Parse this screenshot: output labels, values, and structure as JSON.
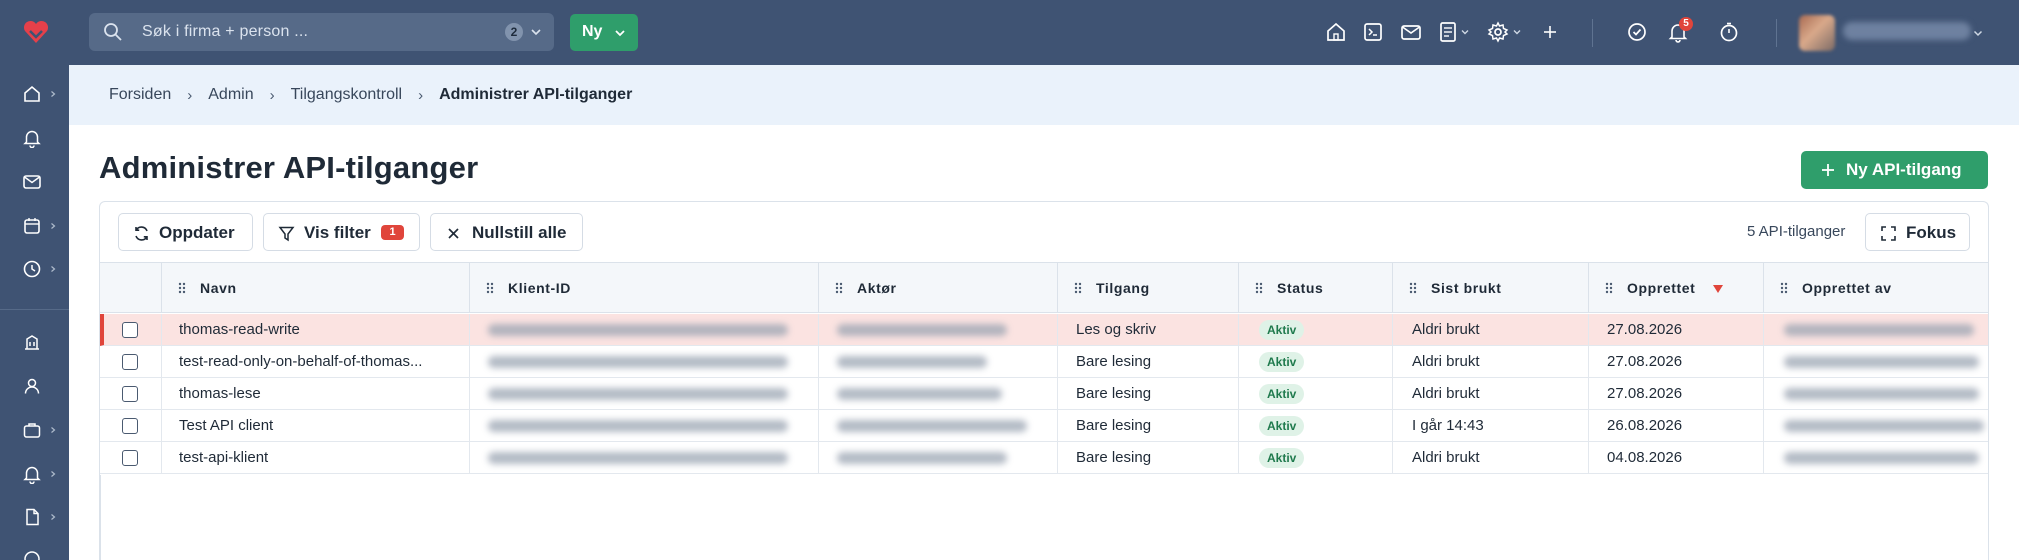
{
  "topbar": {
    "search_placeholder": "Søk i firma + person ...",
    "search_count": "2",
    "new_button": "Ny",
    "notification_count": "5"
  },
  "breadcrumb": [
    "Forsiden",
    "Admin",
    "Tilgangskontroll",
    "Administrer API-tilganger"
  ],
  "page": {
    "title": "Administrer API-tilganger",
    "new_api_button": "Ny API-tilgang"
  },
  "toolbar": {
    "refresh": "Oppdater",
    "show_filter": "Vis filter",
    "filter_count": "1",
    "reset_all": "Nullstill alle",
    "count_text": "5 API-tilganger",
    "focus": "Fokus"
  },
  "table": {
    "columns": [
      "Navn",
      "Klient-ID",
      "Aktør",
      "Tilgang",
      "Status",
      "Sist brukt",
      "Opprettet",
      "Opprettet av"
    ],
    "sorted_column": "Opprettet",
    "sort_direction": "desc",
    "rows": [
      {
        "name": "thomas-read-write",
        "access": "Les og skriv",
        "status": "Aktiv",
        "last_used": "Aldri brukt",
        "created": "27.08.2026",
        "highlighted": true
      },
      {
        "name": "test-read-only-on-behalf-of-thomas...",
        "access": "Bare lesing",
        "status": "Aktiv",
        "last_used": "Aldri brukt",
        "created": "27.08.2026",
        "highlighted": false
      },
      {
        "name": "thomas-lese",
        "access": "Bare lesing",
        "status": "Aktiv",
        "last_used": "Aldri brukt",
        "created": "27.08.2026",
        "highlighted": false
      },
      {
        "name": "Test API client",
        "access": "Bare lesing",
        "status": "Aktiv",
        "last_used": "I går 14:43",
        "created": "26.08.2026",
        "highlighted": false
      },
      {
        "name": "test-api-klient",
        "access": "Bare lesing",
        "status": "Aktiv",
        "last_used": "Aldri brukt",
        "created": "04.08.2026",
        "highlighted": false
      }
    ]
  },
  "colors": {
    "topbar": "#3f5373",
    "accent_green": "#2f9e6b",
    "badge_red": "#e0453b",
    "highlight_row": "#fbe3e1",
    "breadcrumb_bg": "#eaf2fb"
  }
}
